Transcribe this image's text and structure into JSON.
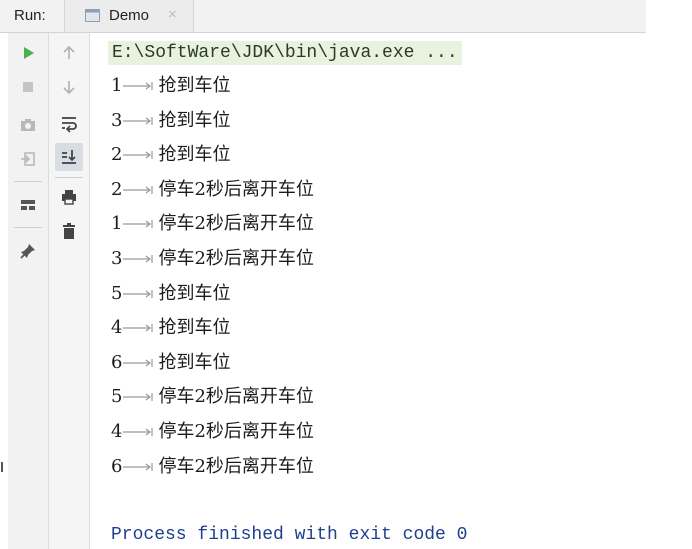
{
  "header": {
    "run_label": "Run:",
    "tab_label": "Demo",
    "tab_close": "×"
  },
  "toolbar_left": [
    {
      "name": "rerun-icon",
      "icon": "play"
    },
    {
      "name": "stop-icon",
      "icon": "stop"
    },
    {
      "name": "camera-icon",
      "icon": "camera"
    },
    {
      "name": "exit-icon",
      "icon": "exit"
    },
    {
      "name": "layout-icon",
      "icon": "layout"
    },
    {
      "name": "pin-icon",
      "icon": "pin"
    }
  ],
  "toolbar_right": [
    {
      "name": "up-arrow-icon",
      "icon": "up"
    },
    {
      "name": "down-arrow-icon",
      "icon": "down"
    },
    {
      "name": "soft-wrap-icon",
      "icon": "wrap"
    },
    {
      "name": "scroll-to-end-icon",
      "icon": "scroll-end"
    },
    {
      "name": "print-icon",
      "icon": "print"
    },
    {
      "name": "trash-icon",
      "icon": "trash"
    }
  ],
  "console": {
    "command": "E:\\SoftWare\\JDK\\bin\\java.exe ...",
    "lines": [
      {
        "id": "1",
        "msg": "抢到车位"
      },
      {
        "id": "3",
        "msg": "抢到车位"
      },
      {
        "id": "2",
        "msg": "抢到车位"
      },
      {
        "id": "2",
        "msg": "停车2秒后离开车位"
      },
      {
        "id": "1",
        "msg": "停车2秒后离开车位"
      },
      {
        "id": "3",
        "msg": "停车2秒后离开车位"
      },
      {
        "id": "5",
        "msg": "抢到车位"
      },
      {
        "id": "4",
        "msg": "抢到车位"
      },
      {
        "id": "6",
        "msg": "抢到车位"
      },
      {
        "id": "5",
        "msg": "停车2秒后离开车位"
      },
      {
        "id": "4",
        "msg": "停车2秒后离开车位"
      },
      {
        "id": "6",
        "msg": "停车2秒后离开车位"
      }
    ],
    "exit_message": "Process finished with exit code 0"
  },
  "colors": {
    "run_green": "#4caf50",
    "exit_blue": "#1f3f8f",
    "command_bg": "#e8f2de"
  }
}
